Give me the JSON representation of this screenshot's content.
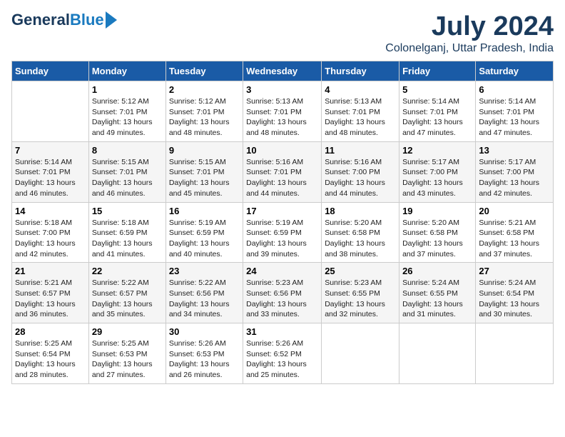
{
  "logo": {
    "general": "General",
    "blue": "Blue"
  },
  "title": "July 2024",
  "location": "Colonelganj, Uttar Pradesh, India",
  "days_of_week": [
    "Sunday",
    "Monday",
    "Tuesday",
    "Wednesday",
    "Thursday",
    "Friday",
    "Saturday"
  ],
  "weeks": [
    [
      {
        "num": "",
        "info": ""
      },
      {
        "num": "1",
        "info": "Sunrise: 5:12 AM\nSunset: 7:01 PM\nDaylight: 13 hours\nand 49 minutes."
      },
      {
        "num": "2",
        "info": "Sunrise: 5:12 AM\nSunset: 7:01 PM\nDaylight: 13 hours\nand 48 minutes."
      },
      {
        "num": "3",
        "info": "Sunrise: 5:13 AM\nSunset: 7:01 PM\nDaylight: 13 hours\nand 48 minutes."
      },
      {
        "num": "4",
        "info": "Sunrise: 5:13 AM\nSunset: 7:01 PM\nDaylight: 13 hours\nand 48 minutes."
      },
      {
        "num": "5",
        "info": "Sunrise: 5:14 AM\nSunset: 7:01 PM\nDaylight: 13 hours\nand 47 minutes."
      },
      {
        "num": "6",
        "info": "Sunrise: 5:14 AM\nSunset: 7:01 PM\nDaylight: 13 hours\nand 47 minutes."
      }
    ],
    [
      {
        "num": "7",
        "info": "Sunrise: 5:14 AM\nSunset: 7:01 PM\nDaylight: 13 hours\nand 46 minutes."
      },
      {
        "num": "8",
        "info": "Sunrise: 5:15 AM\nSunset: 7:01 PM\nDaylight: 13 hours\nand 46 minutes."
      },
      {
        "num": "9",
        "info": "Sunrise: 5:15 AM\nSunset: 7:01 PM\nDaylight: 13 hours\nand 45 minutes."
      },
      {
        "num": "10",
        "info": "Sunrise: 5:16 AM\nSunset: 7:01 PM\nDaylight: 13 hours\nand 44 minutes."
      },
      {
        "num": "11",
        "info": "Sunrise: 5:16 AM\nSunset: 7:00 PM\nDaylight: 13 hours\nand 44 minutes."
      },
      {
        "num": "12",
        "info": "Sunrise: 5:17 AM\nSunset: 7:00 PM\nDaylight: 13 hours\nand 43 minutes."
      },
      {
        "num": "13",
        "info": "Sunrise: 5:17 AM\nSunset: 7:00 PM\nDaylight: 13 hours\nand 42 minutes."
      }
    ],
    [
      {
        "num": "14",
        "info": "Sunrise: 5:18 AM\nSunset: 7:00 PM\nDaylight: 13 hours\nand 42 minutes."
      },
      {
        "num": "15",
        "info": "Sunrise: 5:18 AM\nSunset: 6:59 PM\nDaylight: 13 hours\nand 41 minutes."
      },
      {
        "num": "16",
        "info": "Sunrise: 5:19 AM\nSunset: 6:59 PM\nDaylight: 13 hours\nand 40 minutes."
      },
      {
        "num": "17",
        "info": "Sunrise: 5:19 AM\nSunset: 6:59 PM\nDaylight: 13 hours\nand 39 minutes."
      },
      {
        "num": "18",
        "info": "Sunrise: 5:20 AM\nSunset: 6:58 PM\nDaylight: 13 hours\nand 38 minutes."
      },
      {
        "num": "19",
        "info": "Sunrise: 5:20 AM\nSunset: 6:58 PM\nDaylight: 13 hours\nand 37 minutes."
      },
      {
        "num": "20",
        "info": "Sunrise: 5:21 AM\nSunset: 6:58 PM\nDaylight: 13 hours\nand 37 minutes."
      }
    ],
    [
      {
        "num": "21",
        "info": "Sunrise: 5:21 AM\nSunset: 6:57 PM\nDaylight: 13 hours\nand 36 minutes."
      },
      {
        "num": "22",
        "info": "Sunrise: 5:22 AM\nSunset: 6:57 PM\nDaylight: 13 hours\nand 35 minutes."
      },
      {
        "num": "23",
        "info": "Sunrise: 5:22 AM\nSunset: 6:56 PM\nDaylight: 13 hours\nand 34 minutes."
      },
      {
        "num": "24",
        "info": "Sunrise: 5:23 AM\nSunset: 6:56 PM\nDaylight: 13 hours\nand 33 minutes."
      },
      {
        "num": "25",
        "info": "Sunrise: 5:23 AM\nSunset: 6:55 PM\nDaylight: 13 hours\nand 32 minutes."
      },
      {
        "num": "26",
        "info": "Sunrise: 5:24 AM\nSunset: 6:55 PM\nDaylight: 13 hours\nand 31 minutes."
      },
      {
        "num": "27",
        "info": "Sunrise: 5:24 AM\nSunset: 6:54 PM\nDaylight: 13 hours\nand 30 minutes."
      }
    ],
    [
      {
        "num": "28",
        "info": "Sunrise: 5:25 AM\nSunset: 6:54 PM\nDaylight: 13 hours\nand 28 minutes."
      },
      {
        "num": "29",
        "info": "Sunrise: 5:25 AM\nSunset: 6:53 PM\nDaylight: 13 hours\nand 27 minutes."
      },
      {
        "num": "30",
        "info": "Sunrise: 5:26 AM\nSunset: 6:53 PM\nDaylight: 13 hours\nand 26 minutes."
      },
      {
        "num": "31",
        "info": "Sunrise: 5:26 AM\nSunset: 6:52 PM\nDaylight: 13 hours\nand 25 minutes."
      },
      {
        "num": "",
        "info": ""
      },
      {
        "num": "",
        "info": ""
      },
      {
        "num": "",
        "info": ""
      }
    ]
  ]
}
